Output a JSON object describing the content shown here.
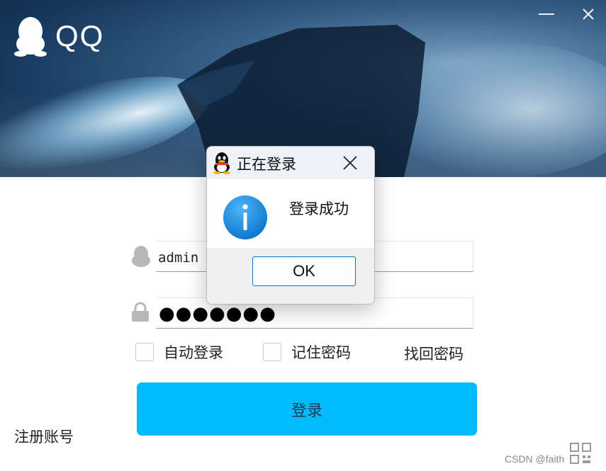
{
  "app": {
    "brand": "QQ"
  },
  "window": {
    "minimize_icon": "minimize-icon",
    "close_icon": "close-icon"
  },
  "form": {
    "username_value": "admin",
    "password_value": "●●●●●●●",
    "auto_login_label": "自动登录",
    "remember_password_label": "记住密码",
    "find_password_label": "找回密码",
    "login_button_label": "登录",
    "register_label": "注册账号",
    "auto_login_checked": false,
    "remember_password_checked": false
  },
  "dialog": {
    "title": "正在登录",
    "message": "登录成功",
    "ok_label": "OK",
    "icon": "info-icon"
  },
  "watermark": "CSDN @faith",
  "colors": {
    "accent": "#00bcff",
    "dialog_title_bg": "#eef1f8",
    "info_blue": "#1a8ee0"
  }
}
